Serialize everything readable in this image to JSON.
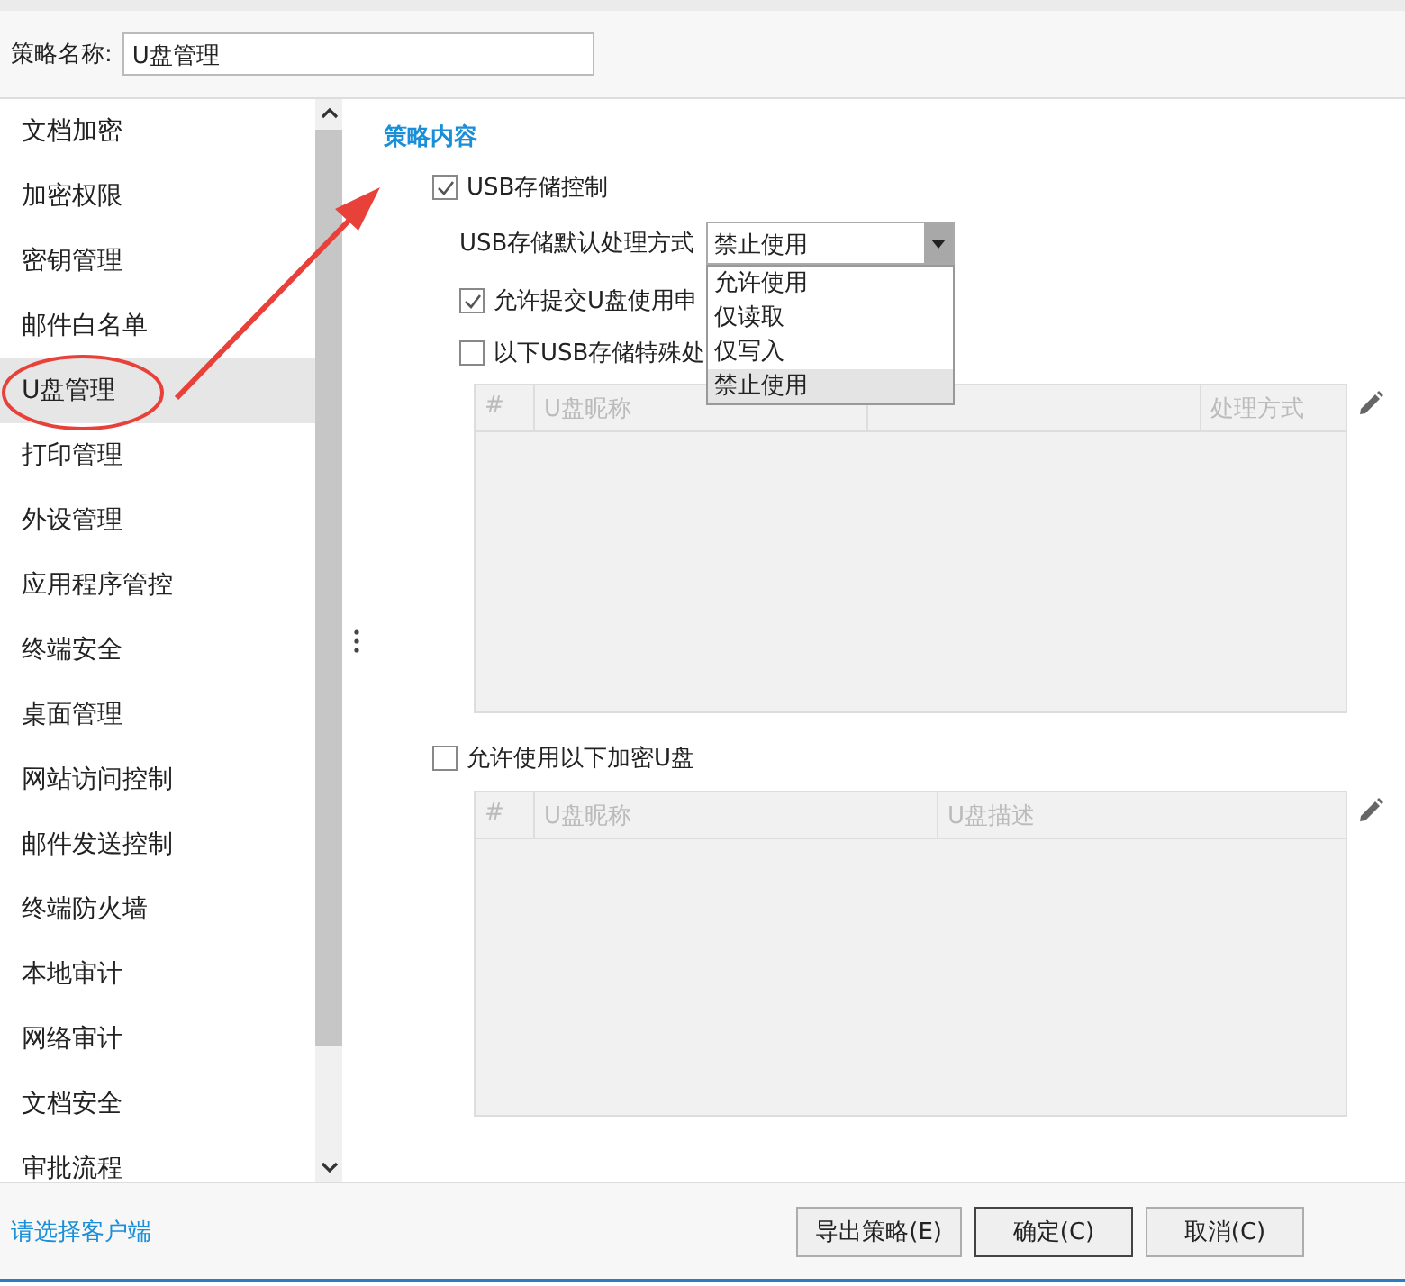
{
  "policy_name": {
    "label": "策略名称:",
    "value": "U盘管理"
  },
  "sidebar": {
    "items": [
      {
        "label": "文档加密",
        "selected": false
      },
      {
        "label": "加密权限",
        "selected": false
      },
      {
        "label": "密钥管理",
        "selected": false
      },
      {
        "label": "邮件白名单",
        "selected": false
      },
      {
        "label": "U盘管理",
        "selected": true
      },
      {
        "label": "打印管理",
        "selected": false
      },
      {
        "label": "外设管理",
        "selected": false
      },
      {
        "label": "应用程序管控",
        "selected": false
      },
      {
        "label": "终端安全",
        "selected": false
      },
      {
        "label": "桌面管理",
        "selected": false
      },
      {
        "label": "网站访问控制",
        "selected": false
      },
      {
        "label": "邮件发送控制",
        "selected": false
      },
      {
        "label": "终端防火墙",
        "selected": false
      },
      {
        "label": "本地审计",
        "selected": false
      },
      {
        "label": "网络审计",
        "selected": false
      },
      {
        "label": "文档安全",
        "selected": false
      },
      {
        "label": "审批流程",
        "selected": false
      }
    ]
  },
  "content": {
    "section_title": "策略内容",
    "usb_control": {
      "label": "USB存储控制",
      "checked": true
    },
    "default_mode": {
      "label": "USB存储默认处理方式",
      "value": "禁止使用",
      "expanded": true,
      "options": [
        {
          "label": "允许使用",
          "selected": false
        },
        {
          "label": "仅读取",
          "selected": false
        },
        {
          "label": "仅写入",
          "selected": false
        },
        {
          "label": "禁止使用",
          "selected": true
        }
      ]
    },
    "allow_request": {
      "label": "允许提交U盘使用申",
      "checked": true
    },
    "special": {
      "label": "以下USB存储特殊处",
      "checked": false
    },
    "special_table": {
      "columns": [
        "#",
        "U盘昵称",
        null,
        "处理方式"
      ]
    },
    "encrypted": {
      "label": "允许使用以下加密U盘",
      "checked": false
    },
    "encrypted_table": {
      "columns": [
        "#",
        "U盘昵称",
        "U盘描述"
      ]
    }
  },
  "footer": {
    "link": "请选择客户端",
    "buttons": [
      {
        "label": "导出策略(E)",
        "kind": "normal"
      },
      {
        "label": "确定(C)",
        "kind": "default"
      },
      {
        "label": "取消(C)",
        "kind": "normal"
      }
    ]
  }
}
